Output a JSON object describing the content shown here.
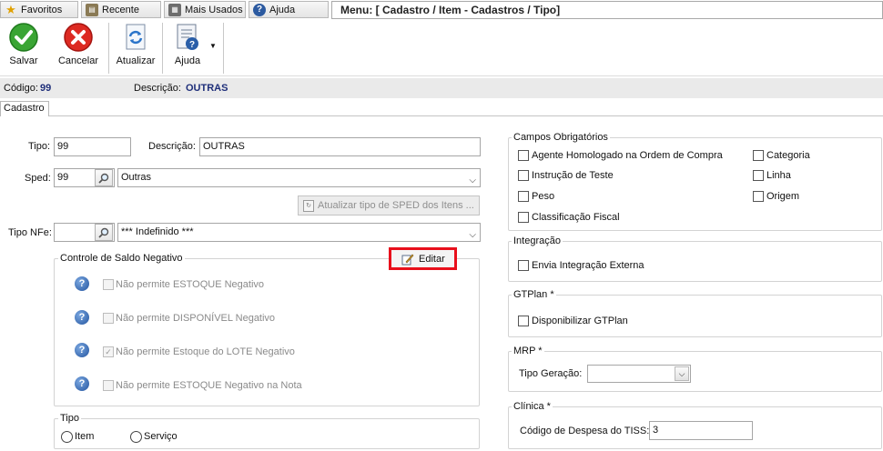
{
  "topbar": {
    "tabs": [
      {
        "label": "Favoritos",
        "icon": "star-icon"
      },
      {
        "label": "Recente",
        "icon": "recent-icon"
      },
      {
        "label": "Mais Usados",
        "icon": "most-used-icon"
      },
      {
        "label": "Ajuda",
        "icon": "help-icon"
      }
    ],
    "menu_path": "Menu: [ Cadastro / Item - Cadastros / Tipo]"
  },
  "toolbar": {
    "save_label": "Salvar",
    "cancel_label": "Cancelar",
    "refresh_label": "Atualizar",
    "help_label": "Ajuda"
  },
  "info": {
    "code_label": "Código:",
    "code_value": "99",
    "desc_label": "Descrição:",
    "desc_value": "OUTRAS"
  },
  "tabs": {
    "active": "Cadastro"
  },
  "form": {
    "tipo_label": "Tipo:",
    "tipo_value": "99",
    "descricao_label": "Descrição:",
    "descricao_value": "OUTRAS",
    "sped_label": "Sped:",
    "sped_code": "99",
    "sped_value": "Outras",
    "sped_update_button": "Atualizar tipo de SPED dos Itens ...",
    "tipo_nfe_label": "Tipo NFe:",
    "tipo_nfe_code": "",
    "tipo_nfe_value": "*** Indefinido ***"
  },
  "saldo": {
    "title": "Controle de Saldo Negativo",
    "edit_button": "Editar",
    "options": [
      {
        "label": "Não permite ESTOQUE Negativo",
        "checked": false
      },
      {
        "label": "Não permite DISPONÍVEL Negativo",
        "checked": false
      },
      {
        "label": "Não permite Estoque do LOTE Negativo",
        "checked": true
      },
      {
        "label": "Não permite ESTOQUE Negativo na Nota",
        "checked": false
      }
    ]
  },
  "tipo_group": {
    "title": "Tipo",
    "options": [
      {
        "label": "Item",
        "selected": false
      },
      {
        "label": "Serviço",
        "selected": false
      }
    ]
  },
  "campos": {
    "title": "Campos Obrigatórios",
    "left": [
      {
        "label": "Agente Homologado na Ordem de Compra",
        "checked": false
      },
      {
        "label": "Instrução de Teste",
        "checked": false
      },
      {
        "label": "Peso",
        "checked": false
      },
      {
        "label": "Classificação Fiscal",
        "checked": false
      }
    ],
    "right": [
      {
        "label": "Categoria",
        "checked": false
      },
      {
        "label": "Linha",
        "checked": false
      },
      {
        "label": "Origem",
        "checked": false
      }
    ]
  },
  "integracao": {
    "title": "Integração",
    "option": "Envia Integração Externa",
    "checked": false
  },
  "gtplan": {
    "title": "GTPlan *",
    "option": "Disponibilizar GTPlan",
    "checked": false
  },
  "mrp": {
    "title": "MRP *",
    "tipo_geracao_label": "Tipo Geração:",
    "tipo_geracao_value": ""
  },
  "clinica": {
    "title": "Clínica *",
    "despesa_label": "Código de Despesa do TISS:",
    "despesa_value": "3"
  },
  "colors": {
    "highlight": "#e8101c",
    "value_blue": "#1f2f7a"
  }
}
